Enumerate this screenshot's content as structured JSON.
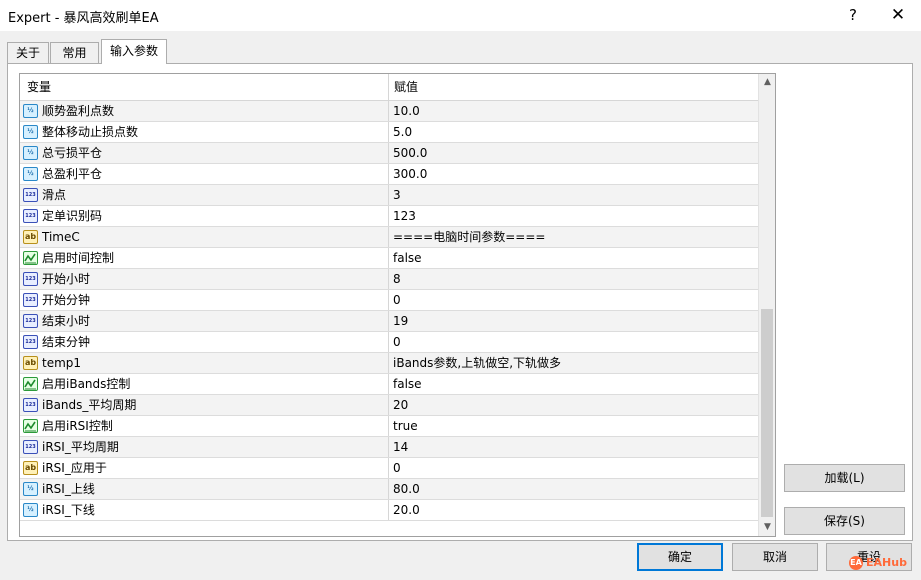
{
  "window": {
    "title": "Expert - 暴风高效刷单EA",
    "help_label": "?",
    "close_label": "✕"
  },
  "tabs": [
    {
      "label": "关于"
    },
    {
      "label": "常用"
    },
    {
      "label": "输入参数"
    }
  ],
  "grid": {
    "headers": {
      "variable": "变量",
      "value": "赋值"
    },
    "rows": [
      {
        "type": "double",
        "type_text": "½",
        "name": "顺势盈利点数",
        "value": "10.0"
      },
      {
        "type": "double",
        "type_text": "½",
        "name": "整体移动止损点数",
        "value": "5.0"
      },
      {
        "type": "double",
        "type_text": "½",
        "name": "总亏损平仓",
        "value": "500.0"
      },
      {
        "type": "double",
        "type_text": "½",
        "name": "总盈利平仓",
        "value": "300.0"
      },
      {
        "type": "int",
        "type_text": "123",
        "name": "滑点",
        "value": "3"
      },
      {
        "type": "int",
        "type_text": "123",
        "name": "定单识别码",
        "value": "123"
      },
      {
        "type": "string",
        "type_text": "ab",
        "name": "TimeC",
        "value": "====电脑时间参数===="
      },
      {
        "type": "bool",
        "type_text": "",
        "name": "启用时间控制",
        "value": "false"
      },
      {
        "type": "int",
        "type_text": "123",
        "name": "开始小时",
        "value": "8"
      },
      {
        "type": "int",
        "type_text": "123",
        "name": "开始分钟",
        "value": "0"
      },
      {
        "type": "int",
        "type_text": "123",
        "name": "结束小时",
        "value": "19"
      },
      {
        "type": "int",
        "type_text": "123",
        "name": "结束分钟",
        "value": "0"
      },
      {
        "type": "string",
        "type_text": "ab",
        "name": "temp1",
        "value": "iBands参数,上轨做空,下轨做多"
      },
      {
        "type": "bool",
        "type_text": "",
        "name": "启用iBands控制",
        "value": "false"
      },
      {
        "type": "int",
        "type_text": "123",
        "name": "iBands_平均周期",
        "value": "20"
      },
      {
        "type": "bool",
        "type_text": "",
        "name": "启用iRSI控制",
        "value": "true"
      },
      {
        "type": "int",
        "type_text": "123",
        "name": "iRSI_平均周期",
        "value": "14"
      },
      {
        "type": "string",
        "type_text": "ab",
        "name": "iRSI_应用于",
        "value": "0"
      },
      {
        "type": "double",
        "type_text": "½",
        "name": "iRSI_上线",
        "value": "80.0"
      },
      {
        "type": "double",
        "type_text": "½",
        "name": "iRSI_下线",
        "value": "20.0"
      }
    ]
  },
  "scrollbar": {
    "up_icon": "▲",
    "down_icon": "▼"
  },
  "buttons": {
    "load": "加载(L)",
    "save": "保存(S)",
    "ok": "确定",
    "cancel": "取消",
    "reset": "重设"
  },
  "watermark": {
    "logo": "EA",
    "text": "EAHub"
  },
  "colors": {
    "accent": "#0078d7",
    "row_alt": "#f3f3f3",
    "watermark": "#ff6a3a"
  }
}
